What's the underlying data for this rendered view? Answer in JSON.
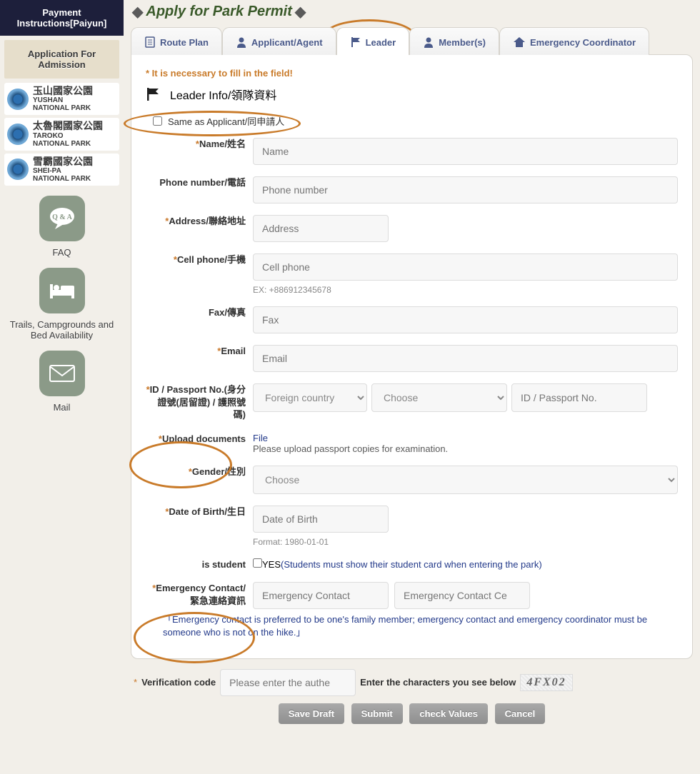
{
  "sidebar": {
    "pay": "Payment Instructions[Paiyun]",
    "adm": "Application For Admission",
    "parks": [
      {
        "cn": "玉山國家公園",
        "en1": "YUSHAN",
        "en2": "NATIONAL PARK"
      },
      {
        "cn": "太魯閣國家公園",
        "en1": "TAROKO",
        "en2": "NATIONAL PARK"
      },
      {
        "cn": "雪霸國家公園",
        "en1": "SHEI-PA",
        "en2": "NATIONAL PARK"
      }
    ],
    "faq": "FAQ",
    "qa": "Q & A",
    "trails": "Trails, Campgrounds and Bed Availability",
    "mail": "Mail"
  },
  "page": {
    "title": "Apply for Park Permit"
  },
  "tabs": {
    "route": "Route Plan",
    "applicant": "Applicant/Agent",
    "leader": "Leader",
    "members": "Member(s)",
    "emcoord": "Emergency Coordinator"
  },
  "notice": "* It is necessary to fill in the field!",
  "section": "Leader Info/領隊資料",
  "same_label": "Same as Applicant/同申請人",
  "fields": {
    "name": {
      "label": "Name/姓名",
      "ph": "Name"
    },
    "phone": {
      "label": "Phone number/電話",
      "ph": "Phone number"
    },
    "addr": {
      "label": "Address/聯絡地址",
      "ph": "Address"
    },
    "cell": {
      "label": "Cell phone/手機",
      "ph": "Cell phone",
      "hint": "EX: +886912345678"
    },
    "fax": {
      "label": "Fax/傳真",
      "ph": "Fax"
    },
    "email": {
      "label": "Email",
      "ph": "Email"
    },
    "id": {
      "label": "ID / Passport No.(身分證號(居留證) / 護照號碼)",
      "sel1": "Foreign country",
      "sel2": "Choose",
      "ph": "ID / Passport No."
    },
    "upload": {
      "label": "Upload documents",
      "link": "File",
      "note": "Please upload passport copies for examination."
    },
    "gender": {
      "label": "Gender/性別",
      "sel": "Choose"
    },
    "dob": {
      "label": "Date of Birth/生日",
      "ph": "Date of Birth",
      "hint": "Format: 1980-01-01"
    },
    "student": {
      "label": "is student",
      "yes": "YES",
      "note": "(Students must show their student card when entering the park)"
    },
    "emc": {
      "label": "Emergency Contact/緊急連絡資訊",
      "ph1": "Emergency Contact",
      "ph2": "Emergency Contact Ce",
      "note": "「Emergency contact is preferred to be one's family member; emergency contact and emergency coordinator must be someone who is not on the hike.」"
    }
  },
  "verify": {
    "label": "Verification code",
    "ph": "Please enter the authe",
    "hint": "Enter the characters you see below",
    "code": "4FX02"
  },
  "btns": {
    "save": "Save Draft",
    "submit": "Submit",
    "check": "check Values",
    "cancel": "Cancel"
  }
}
